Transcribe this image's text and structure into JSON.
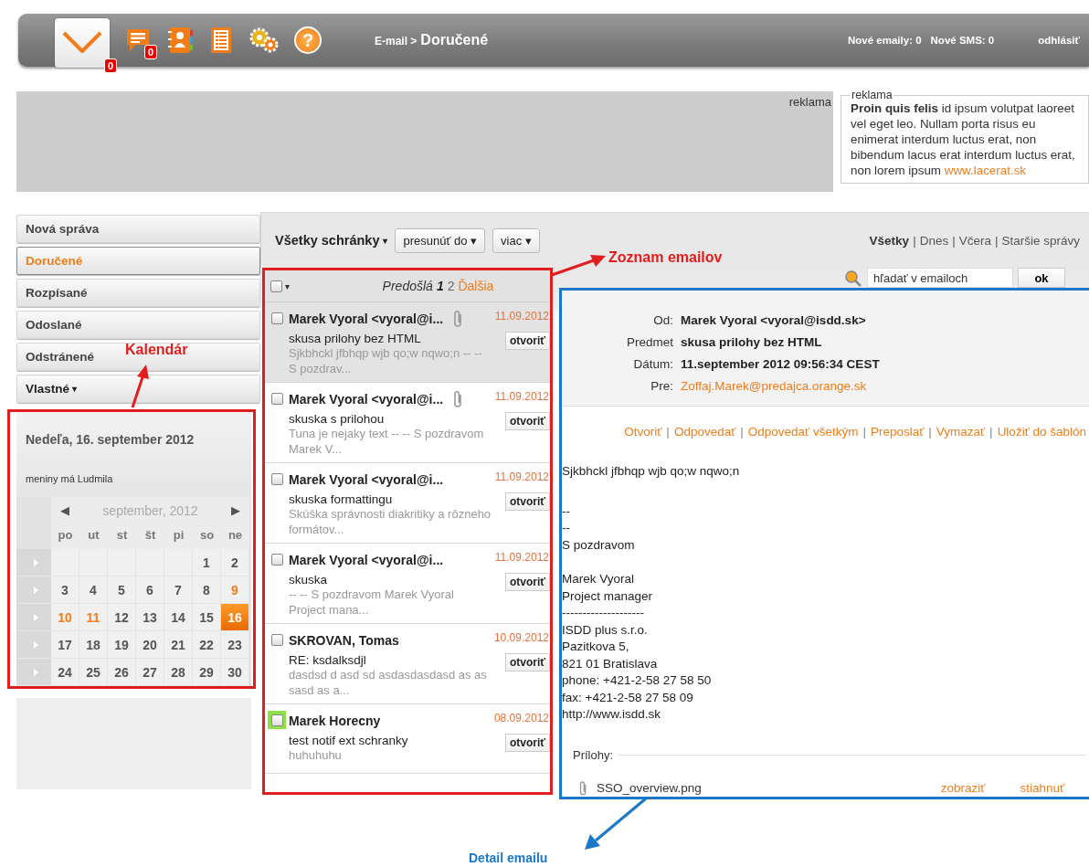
{
  "topbar": {
    "icons": [
      {
        "kind": "mail",
        "badge": "0",
        "selected": true
      },
      {
        "kind": "chat",
        "badge": "0",
        "selected": false
      },
      {
        "kind": "contacts",
        "selected": false
      },
      {
        "kind": "list",
        "selected": false
      },
      {
        "kind": "gears",
        "selected": false
      },
      {
        "kind": "help",
        "glyph": "?",
        "selected": false
      }
    ],
    "breadcrumb_root": "E-mail >",
    "breadcrumb_current": "Doručené",
    "new_emails": "Nové emaily: 0",
    "new_sms": "Nové SMS: 0",
    "logout": "odhlásiť"
  },
  "ad_banner": {
    "label": "reklama"
  },
  "ad_box": {
    "legend": "reklama",
    "text": "**Proin quis felis** id ipsum volutpat laoreet vel eget leo. Nullam porta risus eu enimerat interdum luctus erat, non bibendum lacus erat interdum luctus erat, non lorem ipsum",
    "link": "www.lacerat.sk"
  },
  "sidebar": {
    "items": [
      {
        "label": "Nová správa",
        "selected": false
      },
      {
        "label": "Doručené",
        "selected": true
      },
      {
        "label": "Rozpísané",
        "selected": false
      },
      {
        "label": "Odoslané",
        "selected": false
      },
      {
        "label": "Odstránené",
        "selected": false
      },
      {
        "label": "Vlastné",
        "caret": "▾",
        "selected": false
      }
    ]
  },
  "calendar": {
    "date_title": "Nedeľa, 16. september 2012",
    "nameday": "meniny má Ludmila",
    "prev": "◀",
    "month": "september, 2012",
    "next": "▶",
    "weekdays": [
      "po",
      "ut",
      "st",
      "št",
      "pi",
      "so",
      "ne"
    ],
    "weeks": [
      [
        {
          "kind": "blank"
        },
        {
          "kind": "blank"
        },
        {
          "kind": "blank"
        },
        {
          "kind": "blank"
        },
        {
          "kind": "blank"
        },
        {
          "kind": "day",
          "day": "1",
          "marked": false,
          "selected": false
        },
        {
          "kind": "day",
          "day": "2",
          "marked": false,
          "selected": false
        }
      ],
      [
        {
          "kind": "day",
          "day": "3",
          "marked": false,
          "selected": false
        },
        {
          "kind": "day",
          "day": "4",
          "marked": false,
          "selected": false
        },
        {
          "kind": "day",
          "day": "5",
          "marked": false,
          "selected": false
        },
        {
          "kind": "day",
          "day": "6",
          "marked": false,
          "selected": false
        },
        {
          "kind": "day",
          "day": "7",
          "marked": false,
          "selected": false
        },
        {
          "kind": "day",
          "day": "8",
          "marked": false,
          "selected": false
        },
        {
          "kind": "day",
          "day": "9",
          "marked": true,
          "selected": false
        }
      ],
      [
        {
          "kind": "day",
          "day": "10",
          "marked": true,
          "selected": false
        },
        {
          "kind": "day",
          "day": "11",
          "marked": true,
          "selected": false
        },
        {
          "kind": "day",
          "day": "12",
          "marked": false,
          "selected": false
        },
        {
          "kind": "day",
          "day": "13",
          "marked": false,
          "selected": false
        },
        {
          "kind": "day",
          "day": "14",
          "marked": false,
          "selected": false
        },
        {
          "kind": "day",
          "day": "15",
          "marked": false,
          "selected": false
        },
        {
          "kind": "day",
          "day": "16",
          "marked": false,
          "selected": true
        }
      ],
      [
        {
          "kind": "day",
          "day": "17",
          "marked": false,
          "selected": false
        },
        {
          "kind": "day",
          "day": "18",
          "marked": false,
          "selected": false
        },
        {
          "kind": "day",
          "day": "19",
          "marked": false,
          "selected": false
        },
        {
          "kind": "day",
          "day": "20",
          "marked": false,
          "selected": false
        },
        {
          "kind": "day",
          "day": "21",
          "marked": false,
          "selected": false
        },
        {
          "kind": "day",
          "day": "22",
          "marked": false,
          "selected": false
        },
        {
          "kind": "day",
          "day": "23",
          "marked": false,
          "selected": false
        }
      ],
      [
        {
          "kind": "day",
          "day": "24",
          "marked": false,
          "selected": false
        },
        {
          "kind": "day",
          "day": "25",
          "marked": false,
          "selected": false
        },
        {
          "kind": "day",
          "day": "26",
          "marked": false,
          "selected": false
        },
        {
          "kind": "day",
          "day": "27",
          "marked": false,
          "selected": false
        },
        {
          "kind": "day",
          "day": "28",
          "marked": false,
          "selected": false
        },
        {
          "kind": "day",
          "day": "29",
          "marked": false,
          "selected": false
        },
        {
          "kind": "day",
          "day": "30",
          "marked": false,
          "selected": false
        }
      ]
    ]
  },
  "mail_toolbar": {
    "mailbox": "Všetky schránky",
    "mailbox_caret": "▾",
    "buttons": [
      {
        "label": "presunúť do",
        "caret": "▾"
      },
      {
        "label": "viac",
        "caret": "▾"
      }
    ],
    "separator": "|",
    "filters": [
      {
        "label": "Všetky",
        "selected": true
      },
      {
        "label": "Dnes",
        "selected": false
      },
      {
        "label": "Včera",
        "selected": false
      },
      {
        "label": "Staršie správy",
        "selected": false
      }
    ]
  },
  "email_list": {
    "select_all_checked": false,
    "select_caret": "▾",
    "pager": {
      "prev": "Predošlá",
      "pages": [
        {
          "label": "1",
          "selected": true
        },
        {
          "label": "2",
          "selected": false
        }
      ],
      "next": "Ďalšia"
    },
    "emails": [
      {
        "sender": "Marek Vyoral <vyoral@i...",
        "subject": "skusa prilohy bez HTML",
        "preview": "Sjkbhckl jfbhqp wjb qo;w nqwo;n -- -- S pozdrav...",
        "date": "11.09.2012",
        "open": "otvoriť",
        "attachment": true,
        "checked": false,
        "highlighted": false,
        "selected": true
      },
      {
        "sender": "Marek Vyoral <vyoral@i...",
        "subject": "skuska s prilohou",
        "preview": "Tuna je nejaky text -- -- S pozdravom Marek V...",
        "date": "11.09.2012",
        "open": "otvoriť",
        "attachment": true,
        "checked": false,
        "highlighted": false,
        "selected": false
      },
      {
        "sender": "Marek Vyoral <vyoral@i...",
        "subject": "skuska formattingu",
        "preview": "Skúška správnosti diakritiky a rôzneho formátov...",
        "date": "11.09.2012",
        "open": "otvoriť",
        "attachment": false,
        "checked": false,
        "highlighted": false,
        "selected": false
      },
      {
        "sender": "Marek Vyoral <vyoral@i...",
        "subject": "skuska",
        "preview": "-- -- S pozdravom Marek Vyoral Project mana...",
        "date": "11.09.2012",
        "open": "otvoriť",
        "attachment": false,
        "checked": false,
        "highlighted": false,
        "selected": false
      },
      {
        "sender": "SKROVAN, Tomas",
        "subject": "RE: ksdalksdjl",
        "preview": "dasdsd d asd sd asdasdasdasd as as sasd as a...",
        "date": "10.09.2012",
        "open": "otvoriť",
        "attachment": false,
        "checked": false,
        "highlighted": false,
        "selected": false
      },
      {
        "sender": "Marek Horecny",
        "subject": "test notif ext schranky",
        "preview": "huhuhuhu",
        "date": "08.09.2012",
        "open": "otvoriť",
        "attachment": false,
        "checked": false,
        "highlighted": true,
        "selected": false
      }
    ]
  },
  "search": {
    "placeholder": "hľadať v emailoch",
    "button": "ok"
  },
  "detail": {
    "headers": [
      {
        "label": "Od:",
        "value": "Marek Vyoral <vyoral@isdd.sk>",
        "kind": "text"
      },
      {
        "label": "Predmet",
        "value": "skusa prilohy bez HTML",
        "kind": "text"
      },
      {
        "label": "Dátum:",
        "value": "11.september 2012 09:56:34 CEST",
        "kind": "text"
      },
      {
        "label": "Pre:",
        "value": "Zoffaj.Marek@predajca.orange.sk",
        "kind": "link"
      }
    ],
    "separator": "|",
    "actions": [
      "Otvoriť",
      "Odpovedať",
      "Odpovedať všetkým",
      "Preposlať",
      "Vymazať",
      "Uložiť do šablón"
    ],
    "body": [
      "Sjkbhckl jfbhqp wjb qo;w nqwo;n",
      "--\n--\nS pozdravom",
      "Marek Vyoral\nProject manager\n--------------------\nISDD plus s.r.o.\nPazitkova 5,\n821 01 Bratislava\nphone: +421-2-58 27 58 50\nfax: +421-2-58 27 58 09\nhttp://www.isdd.sk"
    ],
    "attachments_label": "Prílohy:",
    "attachments": [
      {
        "name": "SSO_overview.png",
        "view": "zobraziť",
        "download": "stiahnuť"
      }
    ]
  },
  "annotations": {
    "list_label": "Zoznam emailov",
    "calendar_label": "Kalendár",
    "detail_label": "Detail emailu"
  }
}
